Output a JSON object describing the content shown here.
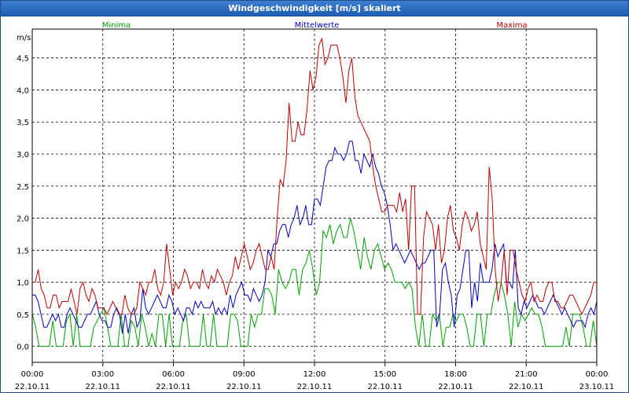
{
  "window": {
    "title": "Windgeschwindigkeit [m/s] skaliert"
  },
  "chart_data": {
    "type": "line",
    "title": "Windgeschwindigkeit [m/s] skaliert",
    "ylabel": "m/s",
    "xlabel": "",
    "ylim": [
      -0.25,
      4.95
    ],
    "xlim": [
      0,
      24
    ],
    "grid": true,
    "legend": "top",
    "yticks": [
      "0,0",
      "0,5",
      "1,0",
      "1,5",
      "2,0",
      "2,5",
      "3,0",
      "3,5",
      "4,0",
      "4,5"
    ],
    "ytick_values": [
      0,
      0.5,
      1.0,
      1.5,
      2.0,
      2.5,
      3.0,
      3.5,
      4.0,
      4.5
    ],
    "xticks": [
      {
        "time": "00:00",
        "date": "22.10.11"
      },
      {
        "time": "03:00",
        "date": "22.10.11"
      },
      {
        "time": "06:00",
        "date": "22.10.11"
      },
      {
        "time": "09:00",
        "date": "22.10.11"
      },
      {
        "time": "12:00",
        "date": "22.10.11"
      },
      {
        "time": "15:00",
        "date": "22.10.11"
      },
      {
        "time": "18:00",
        "date": "22.10.11"
      },
      {
        "time": "21:00",
        "date": "22.10.11"
      },
      {
        "time": "00:00",
        "date": "23.10.11"
      }
    ],
    "series": [
      {
        "name": "Minima",
        "color": "#00a000",
        "values": [
          0.5,
          0.3,
          0,
          0,
          0,
          0,
          0.4,
          0,
          0,
          0,
          0.4,
          0.5,
          0,
          0.5,
          0,
          0,
          0,
          0,
          0.3,
          0.4,
          0.5,
          0.6,
          0.3,
          0,
          0,
          0,
          0.5,
          0,
          0,
          0.4,
          0.3,
          0,
          0.5,
          0.3,
          0,
          0.2,
          0,
          0.5,
          0.5,
          0,
          0.5,
          0,
          0,
          0,
          0.4,
          0.5,
          0,
          0,
          0,
          0,
          0.5,
          0,
          0,
          0.5,
          0,
          0,
          0,
          0,
          0.5,
          0.5,
          0.4,
          0,
          0,
          0,
          0.5,
          0.3,
          0.5,
          0.5,
          0.9,
          0.9,
          0.8,
          0.5,
          1.2,
          1.0,
          0.9,
          1.0,
          1.2,
          1.2,
          0.8,
          1.2,
          1.3,
          1.5,
          1.2,
          0.8,
          1.0,
          1.8,
          1.7,
          1.9,
          1.6,
          1.8,
          1.9,
          1.7,
          1.7,
          2.0,
          1.8,
          1.5,
          1.2,
          1.7,
          1.4,
          1.2,
          1.5,
          1.6,
          1.4,
          1.2,
          1.3,
          1.2,
          1.0,
          1.0,
          1.0,
          0.9,
          1.0,
          0.9,
          0.3,
          0,
          0.5,
          0,
          0,
          0.5,
          0.4,
          0.5,
          0,
          0.3,
          0.3,
          0.5,
          0.4,
          0.5,
          0.5,
          0.3,
          0,
          0,
          0.5,
          0.5,
          0,
          0.5,
          0.5,
          0.8,
          1.0,
          1.0,
          0.8,
          0.5,
          0,
          0.7,
          0.3,
          0.5,
          0.4,
          0.5,
          0.6,
          0.5,
          0.5,
          0.3,
          0,
          0,
          0,
          0,
          0,
          0,
          0.3,
          0,
          0.5,
          0.5,
          0.5,
          0.3,
          0,
          0,
          0.4,
          0
        ],
        "display_note": ""
      },
      {
        "name": "Mittelwerte",
        "color": "#0000c0",
        "values": [
          0.8,
          0.8,
          0.7,
          0.5,
          0.3,
          0.3,
          0.4,
          0.5,
          0.4,
          0.5,
          0.3,
          0.3,
          0.5,
          0.6,
          0.5,
          0.4,
          0.3,
          0.3,
          0.4,
          0.5,
          0.5,
          0.6,
          0.7,
          0.5,
          0.4,
          0.4,
          0.3,
          0.3,
          0.5,
          0.6,
          0.5,
          0.2,
          0.5,
          0.2,
          0.5,
          0.6,
          0.3,
          0.4,
          0.9,
          0.6,
          0.5,
          0.6,
          0.7,
          0.8,
          0.7,
          0.6,
          0.6,
          0.8,
          0.7,
          0.5,
          0.6,
          0.5,
          0.4,
          0.6,
          0.6,
          0.5,
          0.7,
          0.6,
          0.7,
          0.6,
          0.6,
          0.6,
          0.7,
          0.5,
          0.6,
          0.5,
          0.6,
          0.5,
          0.8,
          0.6,
          0.8,
          0.9,
          1.0,
          0.8,
          0.8,
          0.7,
          0.9,
          0.8,
          0.7,
          0.8,
          1.0,
          1.5,
          1.4,
          1.6,
          1.6,
          1.8,
          1.9,
          1.9,
          1.7,
          1.9,
          2.0,
          2.2,
          1.9,
          2.0,
          2.2,
          1.9,
          1.9,
          2.3,
          2.3,
          2.2,
          2.5,
          2.8,
          2.9,
          2.9,
          3.1,
          3.0,
          3.0,
          2.9,
          3.0,
          3.2,
          3.2,
          2.9,
          2.9,
          2.7,
          3.0,
          2.9,
          2.8,
          3.0,
          2.8,
          2.7,
          2.5,
          2.4,
          2.2,
          1.9,
          1.5,
          1.6,
          1.5,
          1.4,
          1.3,
          1.4,
          1.5,
          1.4,
          1.3,
          1.2,
          1.3,
          1.3,
          1.4,
          1.5,
          1.5,
          0.3,
          0.5,
          1.2,
          1.3,
          1.0,
          0.8,
          0.3,
          0.8,
          0.9,
          1.2,
          1.5,
          1.5,
          0.6,
          1.0,
          0.7,
          1.3,
          1.0,
          1.0,
          1.0,
          1.2,
          1.6,
          1.4,
          1.5,
          1.6,
          1.0,
          1.0,
          0.9,
          1.5,
          0.6,
          0.5,
          0.7,
          0.6,
          0.7,
          0.8,
          0.7,
          0.6,
          0.6,
          0.5,
          0.6,
          0.7,
          0.8,
          0.7,
          0.6,
          0.5,
          0.6,
          0.5,
          0.4,
          0.3,
          0.4,
          0.4,
          0.4,
          0.3,
          0.5,
          0.6,
          0.5,
          0.7
        ],
        "display_note": ""
      },
      {
        "name": "Maxima",
        "color": "#c00000",
        "values": [
          1.0,
          1.0,
          1.2,
          0.9,
          0.8,
          0.6,
          0.6,
          0.8,
          0.8,
          0.6,
          0.7,
          0.7,
          0.7,
          0.9,
          0.7,
          0.5,
          0.9,
          1.0,
          0.8,
          0.7,
          0.9,
          0.8,
          0.6,
          0.6,
          0.6,
          0.5,
          0.6,
          0.7,
          0.6,
          0.5,
          0.5,
          0.8,
          0.6,
          0.5,
          0.5,
          0.6,
          1.0,
          0.9,
          0.8,
          1.0,
          1.0,
          1.2,
          0.9,
          0.8,
          1.0,
          1.6,
          1.2,
          0.8,
          1.0,
          0.9,
          1.0,
          1.2,
          1.1,
          0.9,
          1.0,
          1.0,
          0.9,
          1.2,
          1.0,
          0.9,
          1.1,
          1.0,
          1.2,
          1.1,
          1.0,
          0.8,
          1.0,
          1.1,
          1.4,
          1.2,
          1.4,
          1.6,
          1.4,
          1.2,
          1.3,
          1.5,
          1.6,
          1.4,
          1.2,
          1.2,
          1.4,
          1.2,
          2.0,
          2.6,
          2.5,
          2.9,
          3.8,
          3.2,
          3.2,
          3.5,
          3.3,
          3.3,
          3.7,
          4.3,
          4.0,
          4.2,
          4.7,
          4.8,
          4.4,
          4.5,
          4.7,
          4.7,
          4.7,
          4.5,
          4.2,
          3.8,
          4.3,
          4.5,
          3.9,
          3.6,
          3.5,
          3.4,
          3.3,
          3.2,
          2.8,
          2.5,
          2.3,
          2.1,
          2.1,
          2.2,
          2.2,
          2.2,
          2.1,
          2.4,
          2.1,
          2.3,
          1.5,
          2.5,
          2.5,
          0.5,
          0.5,
          1.7,
          2.1,
          2.0,
          1.9,
          1.5,
          1.9,
          1.3,
          1.5,
          2.0,
          2.2,
          1.8,
          1.7,
          1.5,
          1.9,
          2.1,
          2.0,
          1.8,
          1.9,
          2.1,
          1.6,
          1.4,
          1.2,
          2.8,
          2.3,
          1.2,
          0.7,
          1.0,
          1.5,
          0.8,
          1.5,
          1.5,
          1.2,
          1.0,
          0.8,
          0.7,
          0.9,
          1.0,
          0.7,
          0.8,
          0.7,
          0.7,
          0.9,
          1.0,
          1.0,
          0.7,
          0.7,
          0.6,
          0.6,
          0.7,
          0.8,
          0.8,
          0.7,
          0.6,
          0.5,
          0.6,
          0.7,
          0.8,
          1.0,
          1.0
        ],
        "display_note": ""
      }
    ]
  }
}
